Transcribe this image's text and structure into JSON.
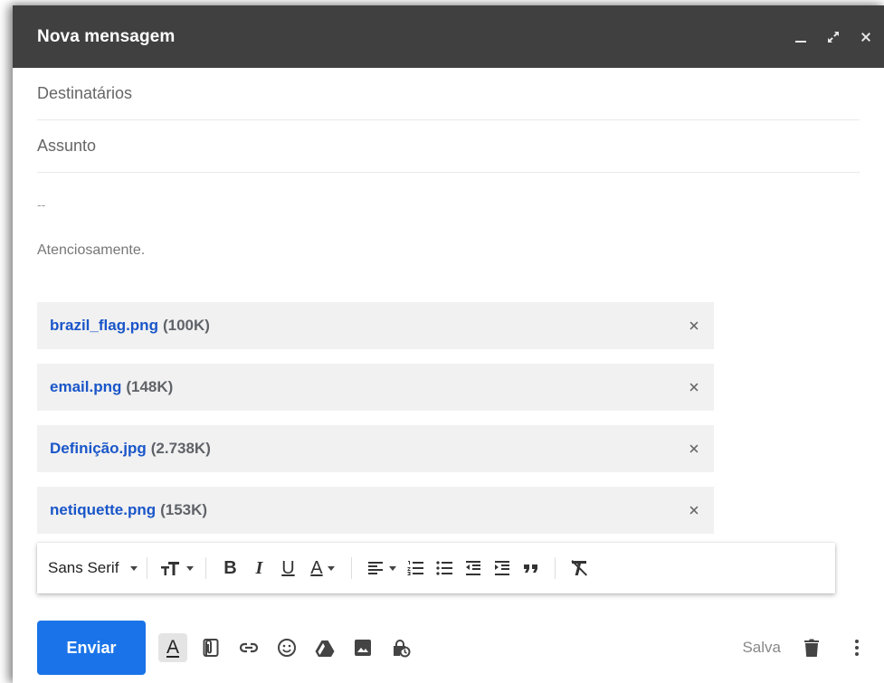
{
  "window": {
    "title": "Nova mensagem"
  },
  "fields": {
    "recipients_placeholder": "Destinatários",
    "subject_placeholder": "Assunto"
  },
  "body": {
    "signature_dash": "--",
    "signature_text": "Atenciosamente."
  },
  "attachments": [
    {
      "name": "brazil_flag.png",
      "size": "(100K)"
    },
    {
      "name": "email.png",
      "size": "(148K)"
    },
    {
      "name": "Definição.jpg",
      "size": "(2.738K)"
    },
    {
      "name": "netiquette.png",
      "size": "(153K)"
    }
  ],
  "formatting": {
    "font": "Sans Serif"
  },
  "footer": {
    "send_label": "Enviar",
    "status": "Salva"
  },
  "colors": {
    "accent": "#1a73e8",
    "link": "#1a56c9",
    "titlebar": "#404040"
  }
}
